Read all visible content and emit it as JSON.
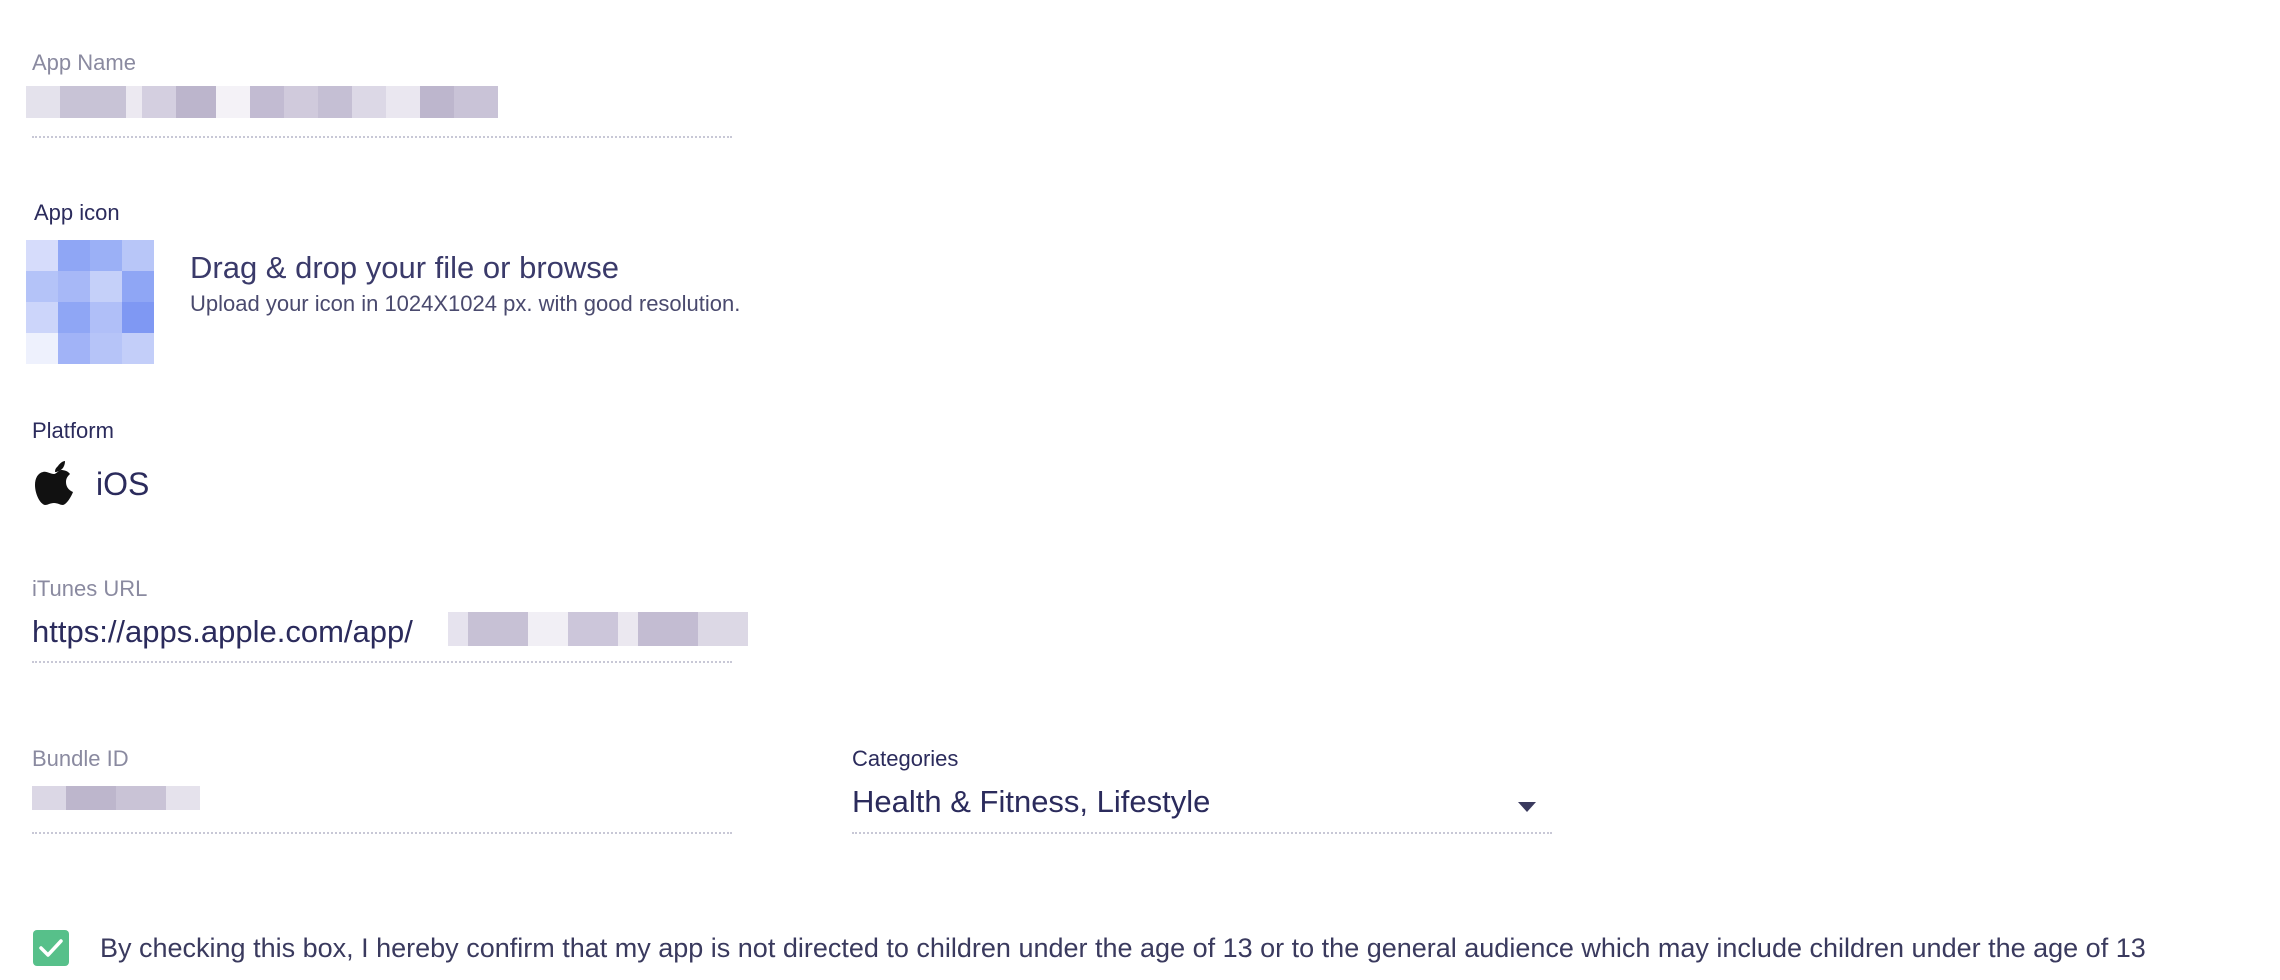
{
  "app_name": {
    "label": "App Name"
  },
  "app_icon": {
    "label": "App icon",
    "upload_title": "Drag & drop your file or browse",
    "upload_hint": "Upload your icon in 1024X1024 px. with good resolution."
  },
  "platform": {
    "label": "Platform",
    "value": "iOS",
    "icon": "apple-icon"
  },
  "itunes_url": {
    "label": "iTunes URL",
    "value_prefix": "https://apps.apple.com/app/"
  },
  "bundle_id": {
    "label": "Bundle ID"
  },
  "categories": {
    "label": "Categories",
    "value": "Health & Fitness, Lifestyle",
    "icon": "caret-down-icon"
  },
  "consent": {
    "checked": true,
    "text": "By checking this box, I hereby confirm that my app is not directed to children under the age of 13 or to the general audience which may include children under the age of 13"
  },
  "colors": {
    "text_primary": "#2b2b5c",
    "label_muted": "#8a8aa0",
    "checkbox_green": "#57c08a",
    "icon_blue": "#8fa6f5"
  }
}
